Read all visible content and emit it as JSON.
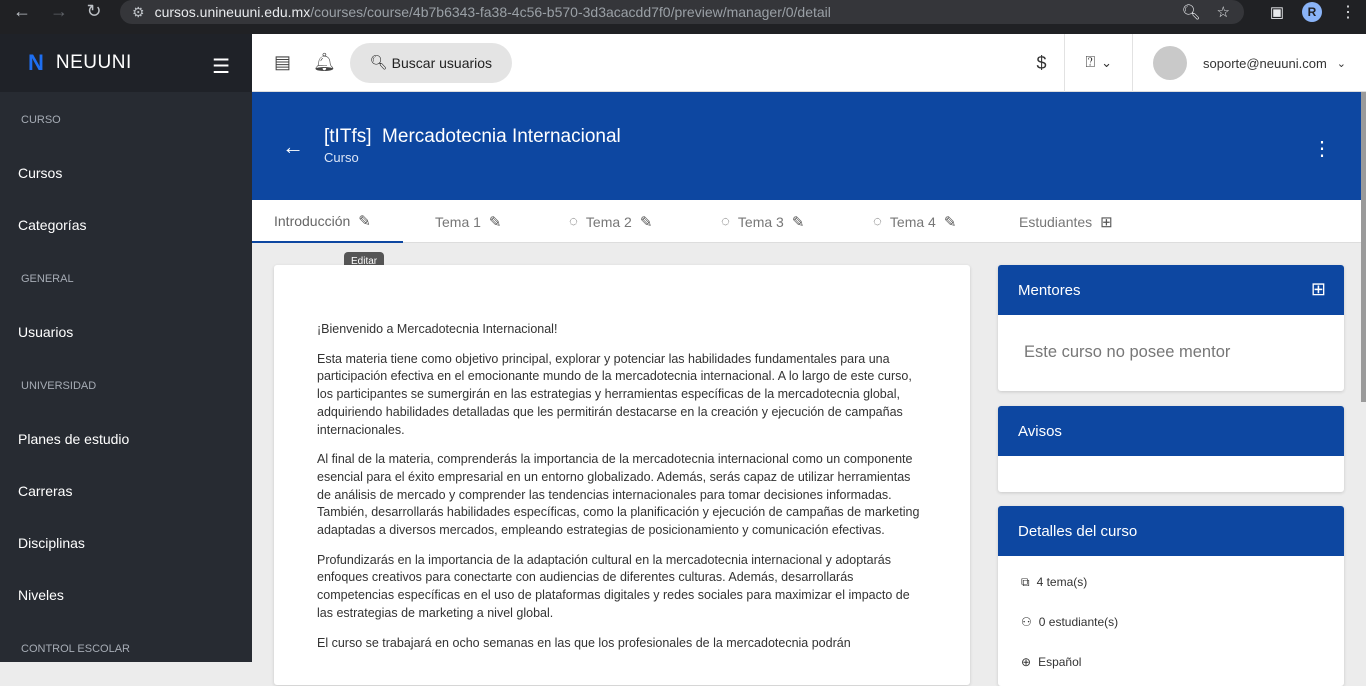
{
  "browser": {
    "url_host": "cursos.unineuuni.edu.mx",
    "url_path": "/courses/course/4b7b6343-fa38-4c56-b570-3d3acacdd7f0/preview/manager/0/detail",
    "profile_initial": "R"
  },
  "sidebar": {
    "brand": "NEUUNI",
    "sections": [
      {
        "title": "CURSO",
        "items": [
          "Cursos",
          "Categorías"
        ]
      },
      {
        "title": "GENERAL",
        "items": [
          "Usuarios"
        ]
      },
      {
        "title": "UNIVERSIDAD",
        "items": [
          "Planes de estudio",
          "Carreras",
          "Disciplinas",
          "Niveles"
        ]
      },
      {
        "title": "CONTROL ESCOLAR",
        "items": []
      }
    ]
  },
  "topbar": {
    "search_label": "Buscar usuarios",
    "user_email": "soporte@neuuni.com"
  },
  "header": {
    "title": "[tITfs]  Mercadotecnia Internacional",
    "subtitle": "Curso"
  },
  "tabs": [
    {
      "label": "Introducción"
    },
    {
      "label": "Tema 1"
    },
    {
      "label": "Tema 2"
    },
    {
      "label": "Tema 3"
    },
    {
      "label": "Tema 4"
    },
    {
      "label": "Estudiantes"
    }
  ],
  "tooltip": "Editar",
  "content": {
    "paragraphs": [
      "¡Bienvenido a Mercadotecnia Internacional!",
      "Esta materia tiene como objetivo principal, explorar y potenciar las habilidades fundamentales para una participación efectiva en el emocionante mundo de la mercadotecnia internacional. A lo largo de este curso, los participantes se sumergirán en las estrategias y herramientas específicas de la mercadotecnia global, adquiriendo habilidades detalladas que les permitirán destacarse en la creación y ejecución de campañas internacionales.",
      "Al final de la materia, comprenderás la importancia de la mercadotecnia internacional como un componente esencial para el éxito empresarial en un entorno globalizado. Además, serás capaz de utilizar herramientas de análisis de mercado y comprender las tendencias internacionales para tomar decisiones informadas. También, desarrollarás habilidades específicas, como la planificación y ejecución de campañas de marketing adaptadas a diversos mercados, empleando estrategias de posicionamiento y comunicación efectivas.",
      "Profundizarás en la importancia de la adaptación cultural en la mercadotecnia internacional y adoptarás enfoques creativos para conectarte con audiencias de diferentes culturas. Además, desarrollarás competencias específicas en el uso de plataformas digitales y redes sociales para maximizar el impacto de las estrategias de marketing a nivel global.",
      "El curso se trabajará en ocho semanas en las que los profesionales de la mercadotecnia podrán"
    ]
  },
  "panels": {
    "mentors_title": "Mentores",
    "mentors_empty": "Este curso no posee mentor",
    "notices_title": "Avisos",
    "details_title": "Detalles del curso",
    "details": [
      "4 tema(s)",
      "0 estudiante(s)",
      "Español"
    ]
  }
}
